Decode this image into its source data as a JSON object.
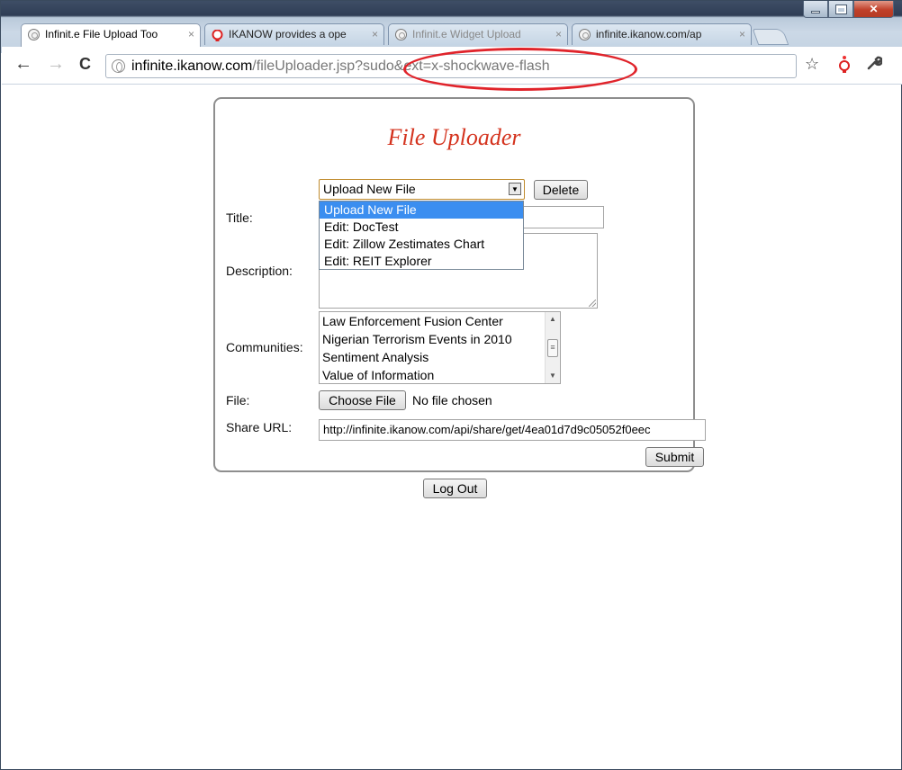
{
  "browser": {
    "tabs": [
      {
        "label": "Infinit.e File Upload Too",
        "active": true,
        "favicon": "globe-icon"
      },
      {
        "label": "IKANOW provides a ope",
        "active": false,
        "favicon": "lightbulb-icon"
      },
      {
        "label": "Infinit.e Widget Upload",
        "active": false,
        "favicon": "globe-icon"
      },
      {
        "label": "infinite.ikanow.com/ap",
        "active": false,
        "favicon": "globe-icon"
      }
    ],
    "tab_close_glyph": "×",
    "url_host": "infinite.ikanow.com",
    "url_path": "/fileUploader.jsp?sudo&ext=x-shockwave-flash",
    "back_glyph": "←",
    "forward_glyph": "→",
    "reload_glyph": "C",
    "star_glyph": "☆",
    "wrench_glyph": "🔧",
    "annotation_color": "#e0242b"
  },
  "form": {
    "title": "File Uploader",
    "title_color": "#d4331e",
    "select_value": "Upload New File",
    "delete_label": "Delete",
    "dropdown_options": [
      "Upload New File",
      "Edit: DocTest",
      "Edit: Zillow Zestimates Chart",
      "Edit: REIT Explorer"
    ],
    "labels": {
      "title": "Title:",
      "description": "Description:",
      "communities": "Communities:",
      "file": "File:",
      "share_url": "Share URL:"
    },
    "communities": [
      "Law Enforcement Fusion Center",
      "Nigerian Terrorism Events in 2010",
      "Sentiment Analysis",
      "Value of Information"
    ],
    "choose_file_label": "Choose File",
    "no_file_text": "No file chosen",
    "share_url_value": "http://infinite.ikanow.com/api/share/get/4ea01d7d9c05052f0eec",
    "submit_label": "Submit",
    "logout_label": "Log Out"
  }
}
